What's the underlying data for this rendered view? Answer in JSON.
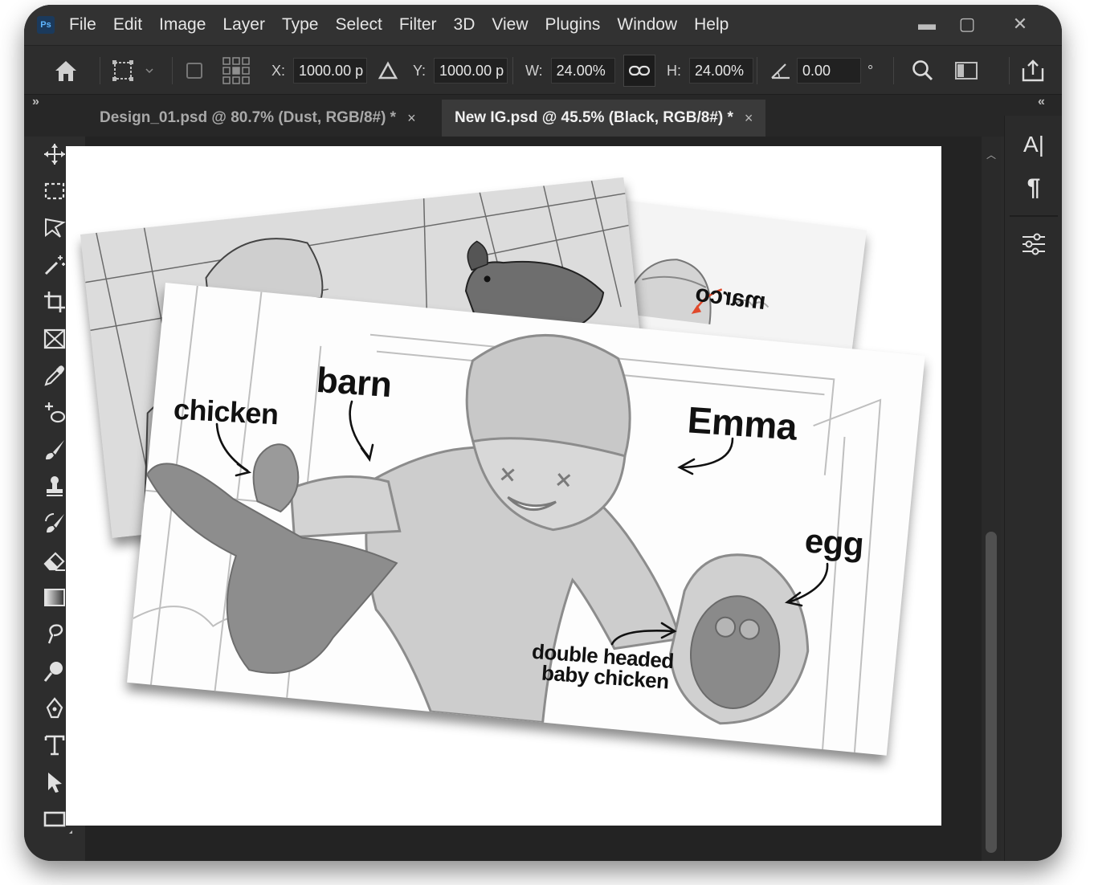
{
  "app": {
    "logo": "Ps"
  },
  "menu": [
    "File",
    "Edit",
    "Image",
    "Layer",
    "Type",
    "Select",
    "Filter",
    "3D",
    "View",
    "Plugins",
    "Window",
    "Help"
  ],
  "window_controls": {
    "minimize": "▬",
    "maximize": "▢",
    "close": "✕"
  },
  "options": {
    "x_label": "X:",
    "x_value": "1000.00 p",
    "y_label": "Y:",
    "y_value": "1000.00 p",
    "w_label": "W:",
    "w_value": "24.00%",
    "h_label": "H:",
    "h_value": "24.00%",
    "angle_value": "0.00",
    "degree": "°"
  },
  "tabs": [
    {
      "label": "Design_01.psd @ 80.7% (Dust, RGB/8#) *",
      "close": "×"
    },
    {
      "label": "New IG.psd @ 45.5% (Black, RGB/8#) *",
      "close": "×"
    }
  ],
  "collapse_left": "»",
  "collapse_right": "«",
  "right_panel": {
    "character": "A|",
    "paragraph": "¶"
  },
  "annotations": {
    "chicken": "chicken",
    "barn": "barn",
    "emma": "Emma",
    "egg": "egg",
    "double_line1": "double headed",
    "double_line2": "baby chicken",
    "marco": "marco"
  },
  "colors": {
    "accent_arrow": "#e0492b",
    "sketch_gray": "#8c8c8c",
    "background": "#2b2b2b"
  }
}
